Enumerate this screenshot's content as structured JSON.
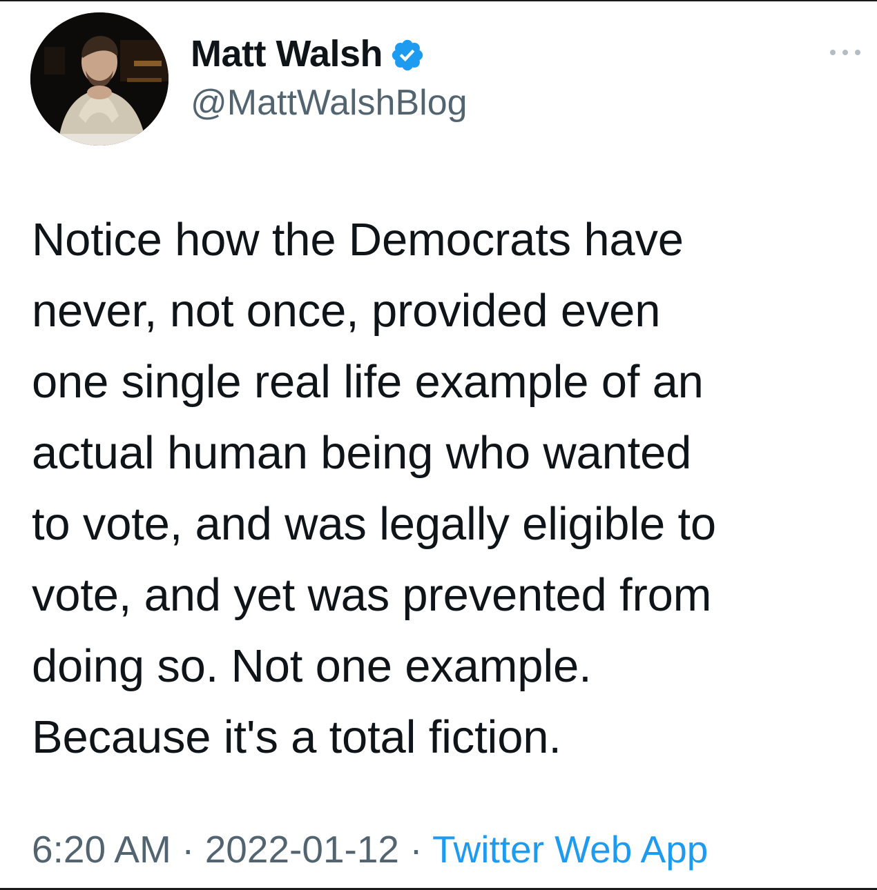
{
  "colors": {
    "text_primary": "#0f1419",
    "text_secondary": "#536471",
    "accent": "#1d9bf0",
    "verified_badge": "#1d9bf0"
  },
  "author": {
    "display_name": "Matt Walsh",
    "handle": "@MattWalshBlog",
    "verified": true
  },
  "icons": {
    "avatar": "profile-photo",
    "verified": "verified-badge-icon",
    "more": "more-options-icon"
  },
  "tweet": {
    "lines": [
      "Notice how the Democrats have",
      "never, not once, provided even",
      "one single real life example of an",
      "actual human being who wanted",
      "to vote, and was legally eligible to",
      "vote, and yet was prevented from",
      "doing so. Not one example.",
      "Because it's a total fiction."
    ]
  },
  "meta": {
    "time": "6:20 AM",
    "separator": "·",
    "date": "2022-01-12",
    "source": "Twitter Web App"
  }
}
